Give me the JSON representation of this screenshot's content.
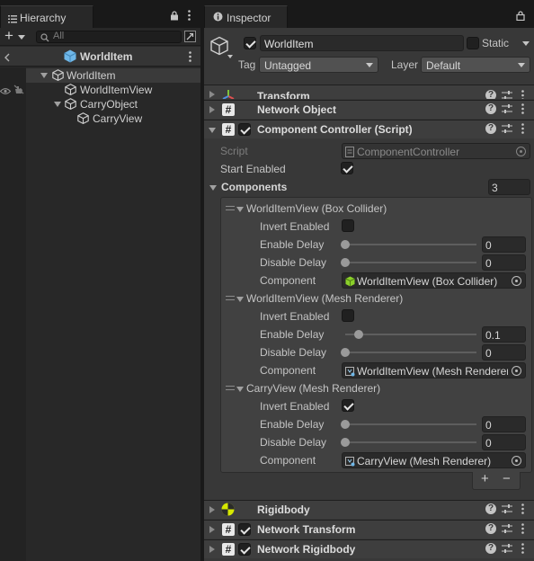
{
  "hierarchy": {
    "tab_label": "Hierarchy",
    "search_placeholder": "All",
    "add_label": "+",
    "scene_title": "WorldItem",
    "items": [
      {
        "label": "WorldItem",
        "depth": 0,
        "expanded": true,
        "selected": true
      },
      {
        "label": "WorldItemView",
        "depth": 1
      },
      {
        "label": "CarryObject",
        "depth": 1,
        "expanded": true
      },
      {
        "label": "CarryView",
        "depth": 2
      }
    ]
  },
  "inspector": {
    "tab_label": "Inspector",
    "object": {
      "active": true,
      "name": "WorldItem",
      "static_label": "Static",
      "static": false,
      "tag_label": "Tag",
      "tag_value": "Untagged",
      "layer_label": "Layer",
      "layer_value": "Default"
    },
    "components_top": [
      {
        "name": "Transform",
        "icon": "transform-icon"
      },
      {
        "name": "Network Object",
        "icon": "script-icon",
        "has_checkbox": false
      },
      {
        "name": "Component Controller (Script)",
        "icon": "script-icon",
        "has_checkbox": true,
        "enabled": true,
        "expanded": true
      }
    ],
    "controller": {
      "script_label": "Script",
      "script_value": "ComponentController",
      "start_enabled_label": "Start Enabled",
      "start_enabled": true,
      "components_label": "Components",
      "components_count": "3",
      "entries": [
        {
          "title": "WorldItemView (Box Collider)",
          "invert_label": "Invert Enabled",
          "invert": false,
          "enable_delay_label": "Enable Delay",
          "enable_delay": "0",
          "enable_fraction": 0.0,
          "disable_delay_label": "Disable Delay",
          "disable_delay": "0",
          "disable_fraction": 0.0,
          "component_label": "Component",
          "component_value": "WorldItemView (Box Collider)",
          "component_icon": "box-collider-icon"
        },
        {
          "title": "WorldItemView (Mesh Renderer)",
          "invert_label": "Invert Enabled",
          "invert": false,
          "enable_delay_label": "Enable Delay",
          "enable_delay": "0.1",
          "enable_fraction": 0.1,
          "disable_delay_label": "Disable Delay",
          "disable_delay": "0",
          "disable_fraction": 0.0,
          "component_label": "Component",
          "component_value": "WorldItemView (Mesh Renderer)",
          "component_icon": "mesh-renderer-icon"
        },
        {
          "title": "CarryView (Mesh Renderer)",
          "invert_label": "Invert Enabled",
          "invert": true,
          "enable_delay_label": "Enable Delay",
          "enable_delay": "0",
          "enable_fraction": 0.0,
          "disable_delay_label": "Disable Delay",
          "disable_delay": "0",
          "disable_fraction": 0.0,
          "component_label": "Component",
          "component_value": "CarryView (Mesh Renderer)",
          "component_icon": "mesh-renderer-icon"
        }
      ],
      "add_label": "+",
      "remove_label": "−"
    },
    "components_bottom": [
      {
        "name": "Rigidbody",
        "icon": "rigidbody-icon"
      },
      {
        "name": "Network Transform",
        "icon": "script-icon",
        "has_checkbox": true,
        "enabled": true
      },
      {
        "name": "Network Rigidbody",
        "icon": "script-icon",
        "has_checkbox": true,
        "enabled": true
      }
    ]
  },
  "colors": {
    "panel_bg": "#383838",
    "hierarchy_bg": "#282828",
    "selection": "#3a3a3a",
    "cube_blue": "#6fb7e8",
    "collider_green": "#8bd02a",
    "rigidbody_yellow": "#d6e800"
  }
}
